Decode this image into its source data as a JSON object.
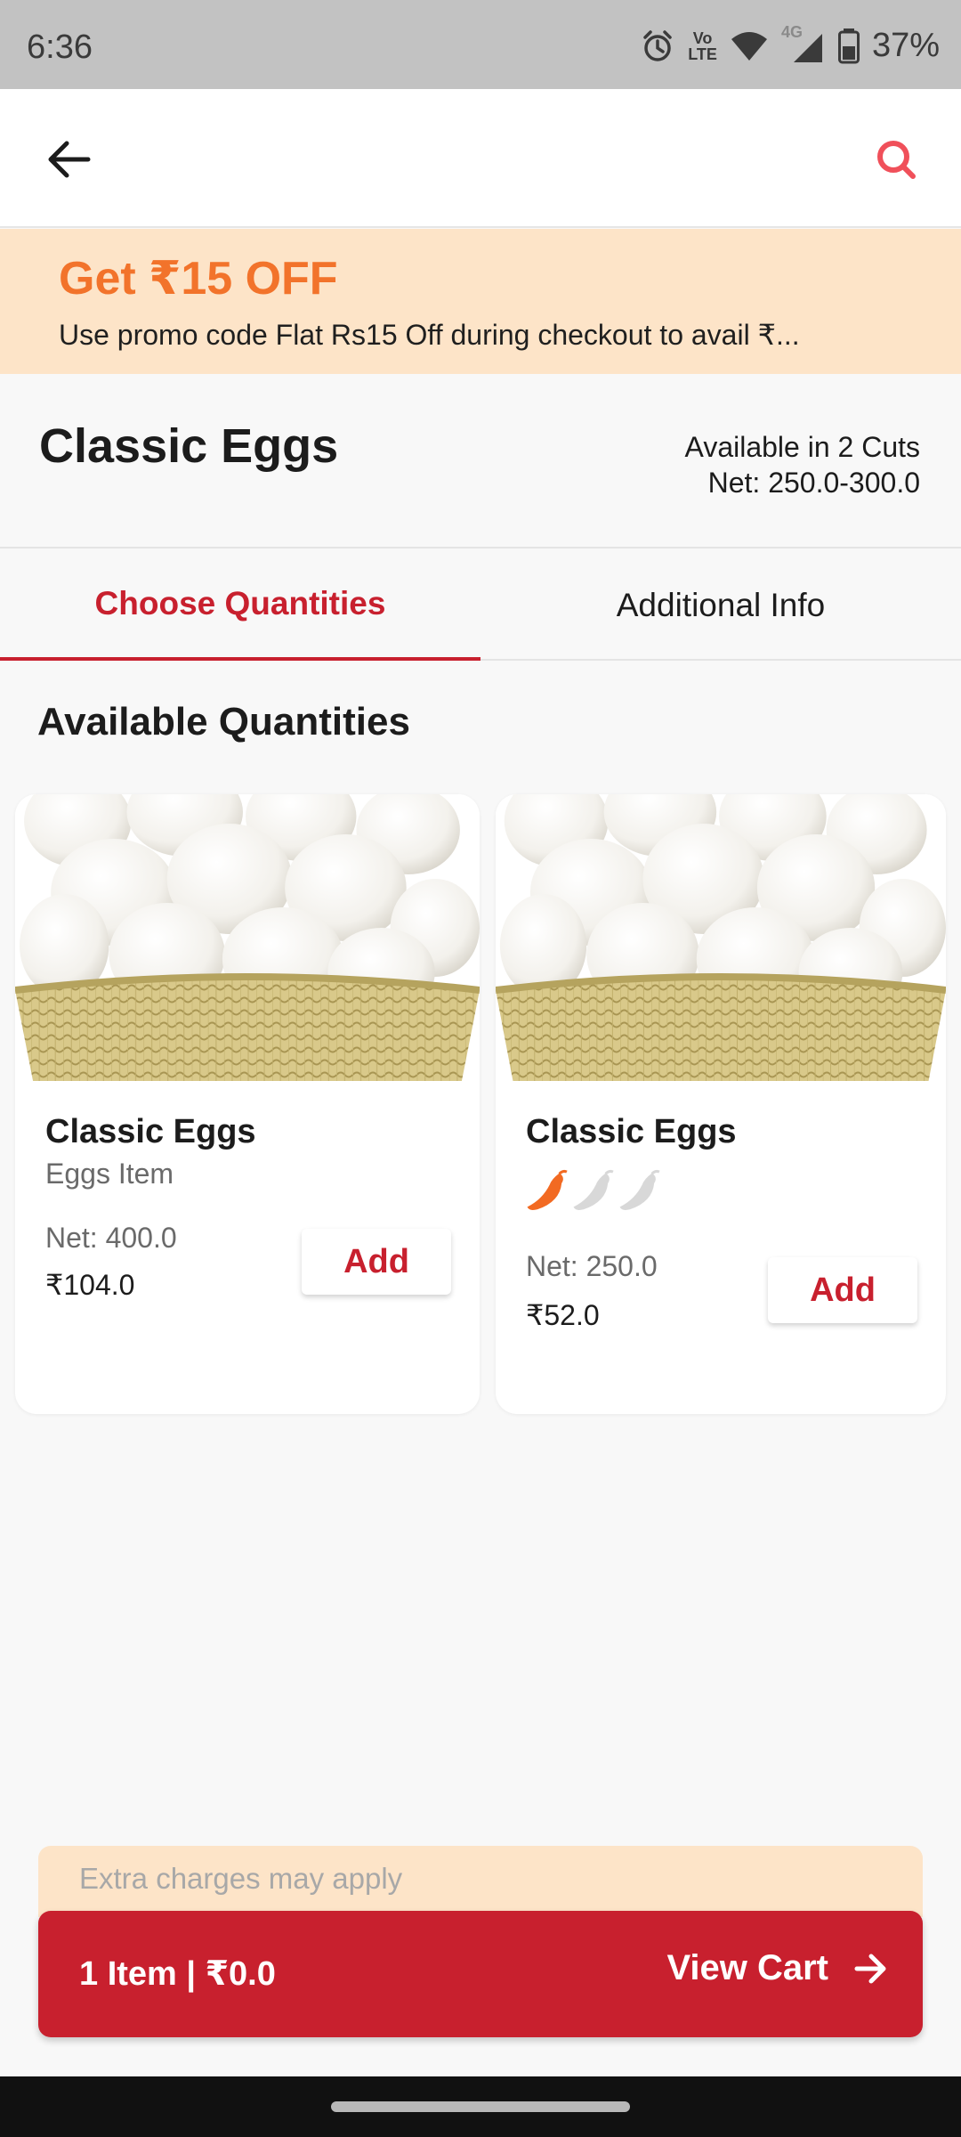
{
  "status_bar": {
    "time": "6:36",
    "battery": "37%",
    "lte_label_top": "Vo",
    "lte_label_bottom": "LTE",
    "network_label": "4G"
  },
  "app_bar": {
    "back_icon": "arrow-left-icon",
    "search_icon": "search-icon",
    "accent_color": "#f0505a"
  },
  "promo": {
    "title": "Get ₹15 OFF",
    "subtitle": "Use promo code Flat Rs15 Off  during checkout to avail ₹...",
    "background": "#fde4c8",
    "title_color": "#f2732b"
  },
  "product": {
    "name": "Classic Eggs",
    "cuts": "Available in 2 Cuts",
    "net": "Net: 250.0-300.0"
  },
  "tabs": [
    {
      "label": "Choose Quantities",
      "active": true
    },
    {
      "label": "Additional Info",
      "active": false
    }
  ],
  "section_title": "Available Quantities",
  "cards": [
    {
      "title": "Classic Eggs",
      "subtitle": "Eggs Item",
      "net": "Net: 400.0",
      "price": "₹104.0",
      "button": "Add",
      "image": "eggs-in-basket"
    },
    {
      "title": "Classic Eggs",
      "spice_level": 1,
      "spice_max": 3,
      "net": "Net: 250.0",
      "price": "₹52.0",
      "button": "Add",
      "image": "eggs-in-basket"
    }
  ],
  "cart": {
    "note": "Extra charges may apply",
    "summary": "1 Item | ₹0.0",
    "view_label": "View Cart",
    "arrow_icon": "arrow-right-icon",
    "color": "#c8202e"
  }
}
